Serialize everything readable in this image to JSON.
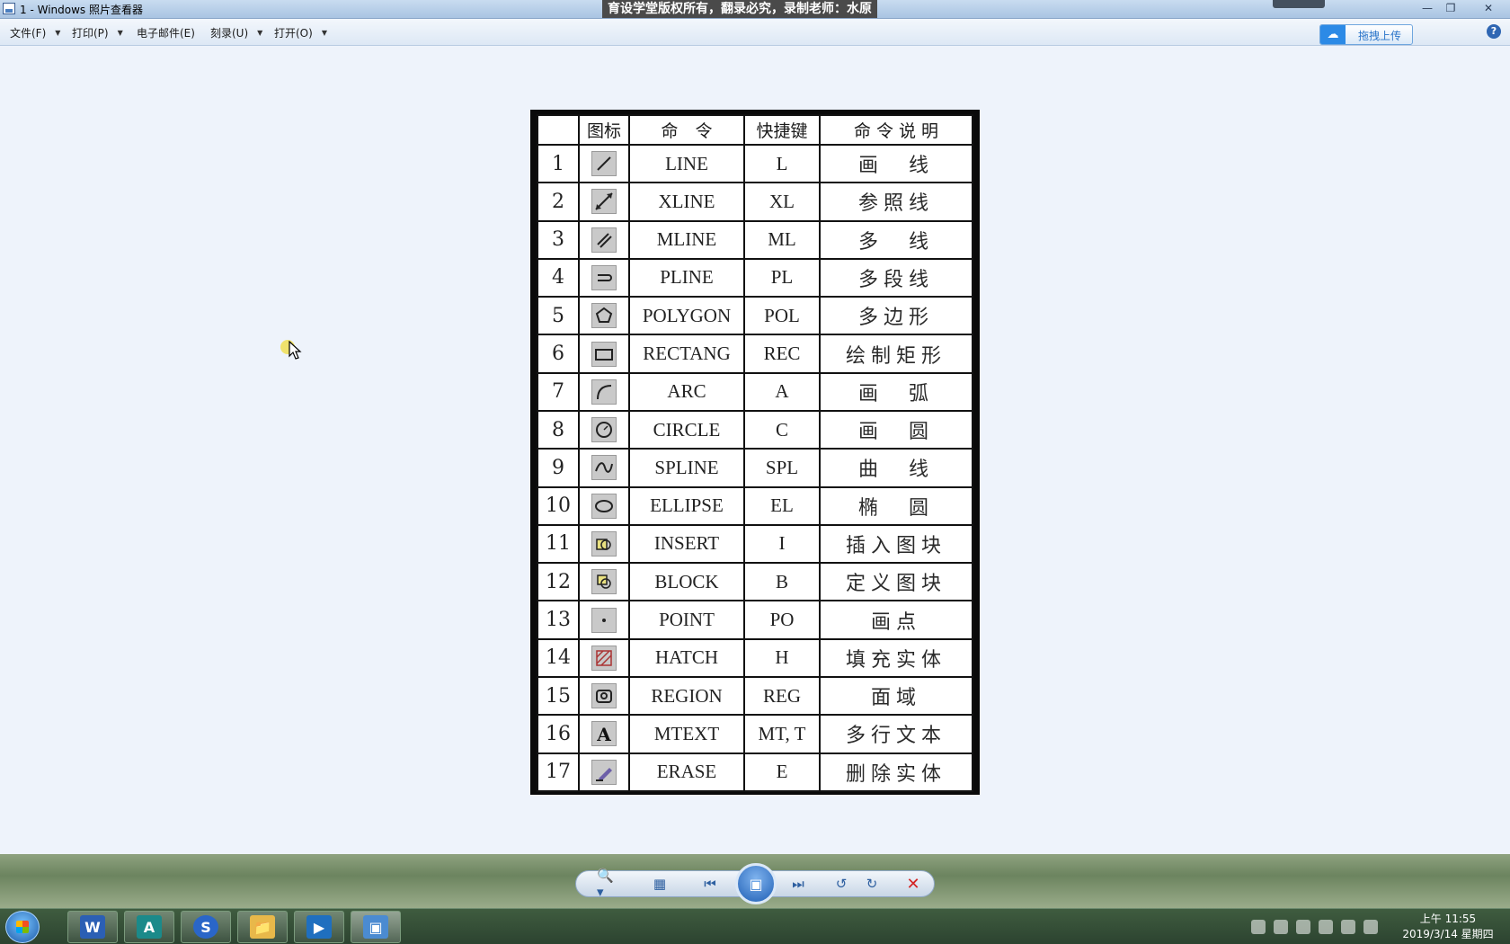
{
  "window": {
    "title": "1 - Windows 照片查看器",
    "overlay_text": "育设学堂版权所有，翻录必究，录制老师：水原"
  },
  "menu": {
    "file": "文件(F)",
    "print": "打印(P)",
    "email": "电子邮件(E)",
    "burn": "刻录(U)",
    "open": "打开(O)",
    "upload": "拖拽上传",
    "help": "?"
  },
  "table": {
    "headers": [
      "",
      "图标",
      "命　令",
      "快捷键",
      "命 令 说 明"
    ],
    "rows": [
      {
        "n": "1",
        "icon": "line-icon",
        "cmd": "LINE",
        "key": "L",
        "desc": "画　线"
      },
      {
        "n": "2",
        "icon": "xline-icon",
        "cmd": "XLINE",
        "key": "XL",
        "desc": "参照线"
      },
      {
        "n": "3",
        "icon": "mline-icon",
        "cmd": "MLINE",
        "key": "ML",
        "desc": "多　线"
      },
      {
        "n": "4",
        "icon": "pline-icon",
        "cmd": "PLINE",
        "key": "PL",
        "desc": "多段线"
      },
      {
        "n": "5",
        "icon": "polygon-icon",
        "cmd": "POLYGON",
        "key": "POL",
        "desc": "多边形"
      },
      {
        "n": "6",
        "icon": "rectang-icon",
        "cmd": "RECTANG",
        "key": "REC",
        "desc": "绘制矩形"
      },
      {
        "n": "7",
        "icon": "arc-icon",
        "cmd": "ARC",
        "key": "A",
        "desc": "画　弧"
      },
      {
        "n": "8",
        "icon": "circle-icon",
        "cmd": "CIRCLE",
        "key": "C",
        "desc": "画　圆"
      },
      {
        "n": "9",
        "icon": "spline-icon",
        "cmd": "SPLINE",
        "key": "SPL",
        "desc": "曲　线"
      },
      {
        "n": "10",
        "icon": "ellipse-icon",
        "cmd": "ELLIPSE",
        "key": "EL",
        "desc": "椭　圆"
      },
      {
        "n": "11",
        "icon": "insert-icon",
        "cmd": "INSERT",
        "key": "I",
        "desc": "插入图块"
      },
      {
        "n": "12",
        "icon": "block-icon",
        "cmd": "BLOCK",
        "key": "B",
        "desc": "定义图块"
      },
      {
        "n": "13",
        "icon": "point-icon",
        "cmd": "POINT",
        "key": "PO",
        "desc": "画点"
      },
      {
        "n": "14",
        "icon": "hatch-icon",
        "cmd": "HATCH",
        "key": "H",
        "desc": "填充实体"
      },
      {
        "n": "15",
        "icon": "region-icon",
        "cmd": "REGION",
        "key": "REG",
        "desc": "面域"
      },
      {
        "n": "16",
        "icon": "mtext-icon",
        "cmd": "MTEXT",
        "key": "MT, T",
        "desc": "多行文本"
      },
      {
        "n": "17",
        "icon": "erase-icon",
        "cmd": "ERASE",
        "key": "E",
        "desc": "删除实体"
      }
    ]
  },
  "controls": {
    "zoom": "zoom-icon",
    "actual_size": "actual-size-icon",
    "previous": "previous-icon",
    "slideshow": "slideshow-icon",
    "next": "next-icon",
    "rotate_left": "rotate-ccw-icon",
    "rotate_right": "rotate-cw-icon",
    "delete": "delete-icon"
  },
  "taskbar": {
    "apps": [
      "word-icon",
      "autocad-icon",
      "sogou-icon",
      "folder-icon",
      "video-icon",
      "photo-viewer-icon"
    ],
    "clock_time": "上午 11:55",
    "clock_date": "2019/3/14 星期四"
  },
  "colors": {
    "accent": "#2c8ae6",
    "window_bg": "#eef3fb",
    "delete": "#d42323"
  }
}
